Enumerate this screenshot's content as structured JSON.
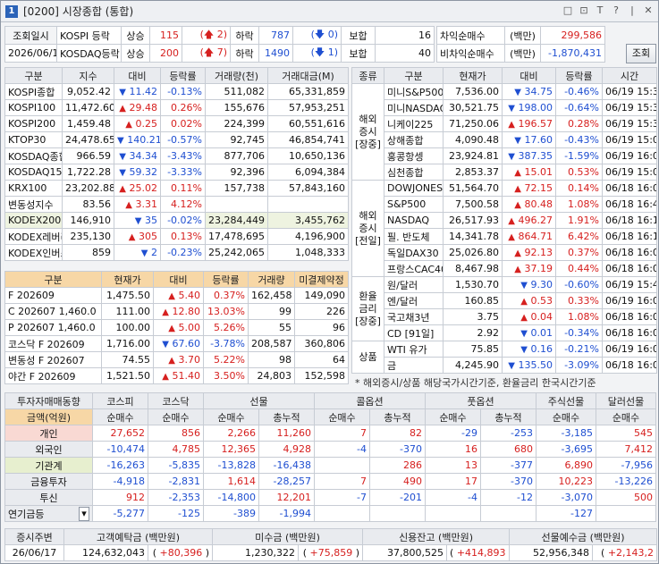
{
  "window": {
    "number": "1",
    "title": "[0200] 시장종합 (통합)",
    "buttons": [
      "□",
      "⊡",
      "T",
      "?",
      "|",
      "✕"
    ]
  },
  "header": {
    "query_label": "조회일시",
    "date": "2026/06/19",
    "rows": [
      {
        "market": "KOSPI 등락",
        "up_label": "상승",
        "up": "115",
        "up_limit": "2",
        "down_label": "하락",
        "down": "787",
        "down_limit": "0",
        "flat_label": "보합",
        "flat": "16"
      },
      {
        "market": "KOSDAQ등락",
        "up_label": "상승",
        "up": "200",
        "up_limit": "7",
        "down_label": "하락",
        "down": "1490",
        "down_limit": "1",
        "flat_label": "보합",
        "flat": "40"
      }
    ],
    "arb": [
      {
        "label": "차익순매수",
        "unit": "(백만)",
        "value": "299,586"
      },
      {
        "label": "비차익순매수",
        "unit": "(백만)",
        "value": "-1,870,431"
      }
    ],
    "query_button": "조회"
  },
  "index": {
    "columns": [
      "구분",
      "지수",
      "대비",
      "등락률",
      "거래량(천)",
      "거래대금(M)"
    ],
    "rows": [
      {
        "name": "KOSPI종합",
        "value": "9,052.42",
        "dir": "dn",
        "change": "11.42",
        "rate": "-0.13%",
        "vol": "511,082",
        "amt": "65,331,859"
      },
      {
        "name": "KOSPI100",
        "value": "11,472.60",
        "dir": "up",
        "change": "29.48",
        "rate": "0.26%",
        "vol": "155,676",
        "amt": "57,953,251"
      },
      {
        "name": "KOSPI200",
        "value": "1,459.48",
        "dir": "up",
        "change": "0.25",
        "rate": "0.02%",
        "vol": "224,399",
        "amt": "60,551,616"
      },
      {
        "name": "KTOP30",
        "value": "24,478.65",
        "dir": "dn",
        "change": "140.21",
        "rate": "-0.57%",
        "vol": "92,745",
        "amt": "46,854,741"
      },
      {
        "name": "KOSDAQ종합",
        "value": "966.59",
        "dir": "dn",
        "change": "34.34",
        "rate": "-3.43%",
        "vol": "877,706",
        "amt": "10,650,136"
      },
      {
        "name": "KOSDAQ150",
        "value": "1,722.28",
        "dir": "dn",
        "change": "59.32",
        "rate": "-3.33%",
        "vol": "92,396",
        "amt": "6,094,384"
      },
      {
        "name": "KRX100",
        "value": "23,202.88",
        "dir": "up",
        "change": "25.02",
        "rate": "0.11%",
        "vol": "157,738",
        "amt": "57,843,160"
      },
      {
        "name": "변동성지수",
        "value": "83.56",
        "dir": "up",
        "change": "3.31",
        "rate": "4.12%",
        "vol": "",
        "amt": ""
      },
      {
        "name": "KODEX200",
        "value": "146,910",
        "dir": "dn",
        "change": "35",
        "rate": "-0.02%",
        "vol": "23,284,449",
        "amt": "3,455,762",
        "hl": true
      },
      {
        "name": "KODEX레버리",
        "value": "235,130",
        "dir": "up",
        "change": "305",
        "rate": "0.13%",
        "vol": "17,478,695",
        "amt": "4,196,900"
      },
      {
        "name": "KODEX인버스",
        "value": "859",
        "dir": "dn",
        "change": "2",
        "rate": "-0.23%",
        "vol": "25,242,065",
        "amt": "1,048,333"
      }
    ]
  },
  "futures": {
    "columns": [
      "구분",
      "현재가",
      "대비",
      "등락률",
      "거래량",
      "미결제약정"
    ],
    "rows": [
      {
        "name": "F 202609",
        "value": "1,475.50",
        "dir": "up",
        "change": "5.40",
        "rate": "0.37%",
        "vol": "162,458",
        "oi": "149,090"
      },
      {
        "name": "C 202607 1,460.0",
        "value": "111.00",
        "dir": "up",
        "change": "12.80",
        "rate": "13.03%",
        "vol": "99",
        "oi": "226"
      },
      {
        "name": "P 202607 1,460.0",
        "value": "100.00",
        "dir": "up",
        "change": "5.00",
        "rate": "5.26%",
        "vol": "55",
        "oi": "96"
      },
      {
        "name": "코스닥 F 202609",
        "value": "1,716.00",
        "dir": "dn",
        "change": "67.60",
        "rate": "-3.78%",
        "vol": "208,587",
        "oi": "360,806"
      },
      {
        "name": "변동성 F 202607",
        "value": "74.55",
        "dir": "up",
        "change": "3.70",
        "rate": "5.22%",
        "vol": "98",
        "oi": "64"
      },
      {
        "name": "야간 F 202609",
        "value": "1,521.50",
        "dir": "up",
        "change": "51.40",
        "rate": "3.50%",
        "vol": "24,803",
        "oi": "152,598"
      }
    ]
  },
  "overseas": {
    "columns": [
      "종류",
      "구분",
      "현재가",
      "대비",
      "등락률",
      "시간"
    ],
    "groups": [
      {
        "label": "해외\n증시\n[장중]",
        "rows": [
          {
            "name": "미니S&P500",
            "value": "7,536.00",
            "dir": "dn",
            "change": "34.75",
            "rate": "-0.46%",
            "time": "06/19 15:36"
          },
          {
            "name": "미니NASDAQ",
            "value": "30,521.75",
            "dir": "dn",
            "change": "198.00",
            "rate": "-0.64%",
            "time": "06/19 15:36"
          },
          {
            "name": "니케이225",
            "value": "71,250.06",
            "dir": "up",
            "change": "196.57",
            "rate": "0.28%",
            "time": "06/19 15:36"
          },
          {
            "name": "상해종합",
            "value": "4,090.48",
            "dir": "dn",
            "change": "17.60",
            "rate": "-0.43%",
            "time": "06/19 15:00"
          },
          {
            "name": "홍콩항셍",
            "value": "23,924.81",
            "dir": "dn",
            "change": "387.35",
            "rate": "-1.59%",
            "time": "06/19 16:08"
          },
          {
            "name": "심천종합",
            "value": "2,853.37",
            "dir": "up",
            "change": "15.01",
            "rate": "0.53%",
            "time": "06/19 15:00"
          }
        ]
      },
      {
        "label": "해외\n증시\n[전일]",
        "rows": [
          {
            "name": "DOWJONES",
            "value": "51,564.70",
            "dir": "up",
            "change": "72.15",
            "rate": "0.14%",
            "time": "06/18 16:00"
          },
          {
            "name": "S&P500",
            "value": "7,500.58",
            "dir": "up",
            "change": "80.48",
            "rate": "1.08%",
            "time": "06/18 16:42"
          },
          {
            "name": "NASDAQ",
            "value": "26,517.93",
            "dir": "up",
            "change": "496.27",
            "rate": "1.91%",
            "time": "06/18 16:15"
          },
          {
            "name": "필. 반도체",
            "value": "14,341.78",
            "dir": "up",
            "change": "864.71",
            "rate": "6.42%",
            "time": "06/18 16:15"
          },
          {
            "name": "독일DAX30",
            "value": "25,026.80",
            "dir": "up",
            "change": "92.13",
            "rate": "0.37%",
            "time": "06/18 16:00"
          },
          {
            "name": "프랑스CAC40",
            "value": "8,467.98",
            "dir": "up",
            "change": "37.19",
            "rate": "0.44%",
            "time": "06/18 16:00"
          }
        ]
      },
      {
        "label": "환율\n금리\n[장중]",
        "rows": [
          {
            "name": "원/달러",
            "value": "1,530.70",
            "dir": "dn",
            "change": "9.30",
            "rate": "-0.60%",
            "time": "06/19 15:41"
          },
          {
            "name": "엔/달러",
            "value": "160.85",
            "dir": "up",
            "change": "0.53",
            "rate": "0.33%",
            "time": "06/19 16:00"
          },
          {
            "name": "국고채3년",
            "value": "3.75",
            "dir": "up",
            "change": "0.04",
            "rate": "1.08%",
            "time": "06/18 16:00"
          },
          {
            "name": "CD [91일]",
            "value": "2.92",
            "dir": "dn",
            "change": "0.01",
            "rate": "-0.34%",
            "time": "06/18 16:00"
          }
        ]
      },
      {
        "label": "상품",
        "rows": [
          {
            "name": "WTI 유가",
            "value": "75.85",
            "dir": "dn",
            "change": "0.16",
            "rate": "-0.21%",
            "time": "06/19 16:00"
          },
          {
            "name": "금",
            "value": "4,245.90",
            "dir": "dn",
            "change": "135.50",
            "rate": "-3.09%",
            "time": "06/18 16:00"
          }
        ]
      }
    ],
    "note": "* 해외증시/상품 해당국가시간기준, 환율금리 한국시간기준"
  },
  "flow": {
    "top": [
      "투자자매매동향",
      "코스피",
      "코스닥",
      "선물",
      "콜옵션",
      "풋옵션",
      "주식선물",
      "달러선물"
    ],
    "sub": [
      "금액(억원)",
      "순매수",
      "순매수",
      "순매수",
      "총누적",
      "순매수",
      "총누적",
      "순매수",
      "총누적",
      "순매수",
      "순매수"
    ],
    "rows": [
      {
        "cat": "개인",
        "bg": "#f9d9d3",
        "vals": [
          "27,652",
          "856",
          "2,266",
          "11,260",
          "7",
          "82",
          "-29",
          "-253",
          "-3,185",
          "545"
        ]
      },
      {
        "cat": "외국인",
        "bg": "#e9ebef",
        "vals": [
          "-10,474",
          "4,785",
          "12,365",
          "4,928",
          "-4",
          "-370",
          "16",
          "680",
          "-3,695",
          "7,412"
        ]
      },
      {
        "cat": "기관계",
        "bg": "#e7efcf",
        "vals": [
          "-16,263",
          "-5,835",
          "-13,828",
          "-16,438",
          "",
          "286",
          "13",
          "-377",
          "6,890",
          "-7,956"
        ]
      },
      {
        "cat": "금융투자",
        "bg": "#e9ebef",
        "vals": [
          "-4,918",
          "-2,831",
          "1,614",
          "-28,257",
          "7",
          "490",
          "17",
          "-370",
          "10,223",
          "-13,226"
        ]
      },
      {
        "cat": "투신",
        "bg": "#e9ebef",
        "vals": [
          "912",
          "-2,353",
          "-14,800",
          "12,201",
          "-7",
          "-201",
          "-4",
          "-12",
          "-3,070",
          "500"
        ]
      },
      {
        "cat": "연기금등",
        "bg": "#e9ebef",
        "vals": [
          "-5,277",
          "-125",
          "-389",
          "-1,994",
          "",
          "",
          "",
          "",
          "-127",
          ""
        ]
      }
    ]
  },
  "footer": {
    "columns": [
      "증시주변",
      "고객예탁금 (백만원)",
      "미수금 (백만원)",
      "신용잔고 (백만원)",
      "선물예수금 (백만원)"
    ],
    "date": "26/06/17",
    "deposit": "124,632,043",
    "deposit_chg": "+80,396",
    "unpaid": "1,230,322",
    "unpaid_chg": "+75,859",
    "credit": "37,800,525",
    "credit_chg": "+414,893",
    "fut_dep": "52,956,348",
    "fut_dep_chg": "+2,143,2"
  }
}
